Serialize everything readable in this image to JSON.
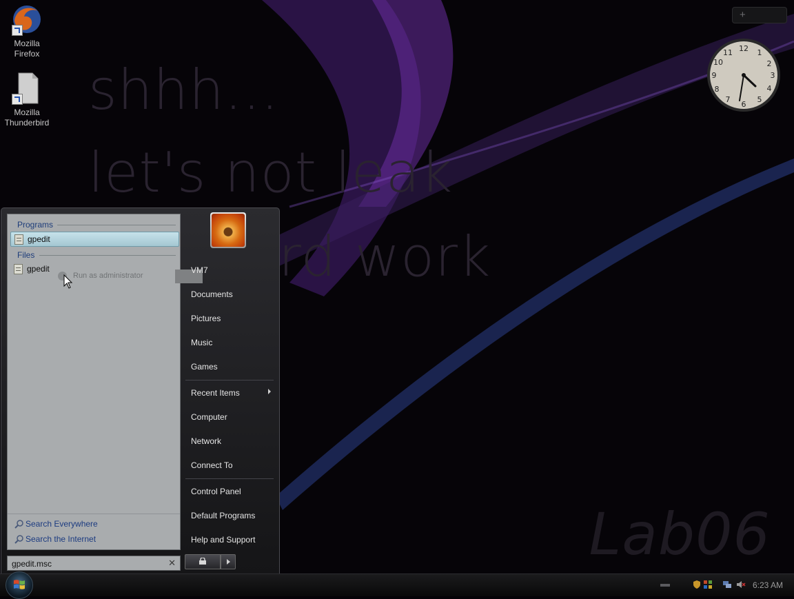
{
  "desktop": {
    "icons": [
      {
        "label_line1": "Mozilla",
        "label_line2": "Firefox",
        "icon": "firefox-icon"
      },
      {
        "label_line1": "Mozilla",
        "label_line2": "Thunderbird",
        "icon": "thunderbird-icon"
      }
    ],
    "wallpaper": {
      "line1": "shhh...",
      "line2": "let's not leak",
      "line3": "rd work",
      "watermark": "Lab06"
    }
  },
  "gadgets": {
    "sidebar_add_icon": "plus-icon",
    "clock": {
      "hour": 4,
      "minute": 23
    }
  },
  "start_menu": {
    "programs_heading": "Programs",
    "files_heading": "Files",
    "programs": [
      {
        "label": "gpedit",
        "icon": "document-icon",
        "selected": true
      }
    ],
    "files": [
      {
        "label": "gpedit",
        "icon": "document-icon"
      }
    ],
    "context_hint": "Run as administrator",
    "search_links": [
      {
        "label": "Search Everywhere",
        "icon": "magnifier-icon"
      },
      {
        "label": "Search the Internet",
        "icon": "magnifier-icon"
      }
    ],
    "search": {
      "value": "gpedit.msc",
      "clear_icon": "close-icon"
    },
    "right_items": [
      {
        "label": "VM7"
      },
      {
        "label": "Documents"
      },
      {
        "label": "Pictures"
      },
      {
        "label": "Music"
      },
      {
        "label": "Games"
      },
      {
        "label": "Recent Items"
      },
      {
        "label": "Computer"
      },
      {
        "label": "Network"
      },
      {
        "label": "Connect To"
      },
      {
        "label": "Control Panel"
      },
      {
        "label": "Default Programs"
      },
      {
        "label": "Help and Support"
      }
    ]
  },
  "taskbar": {
    "time": "6:23 AM"
  },
  "colors": {
    "menu_bg": "#1d1d20",
    "left_pane": "#a9acae",
    "link": "#1c3b80",
    "selection": "#b5d6df"
  }
}
